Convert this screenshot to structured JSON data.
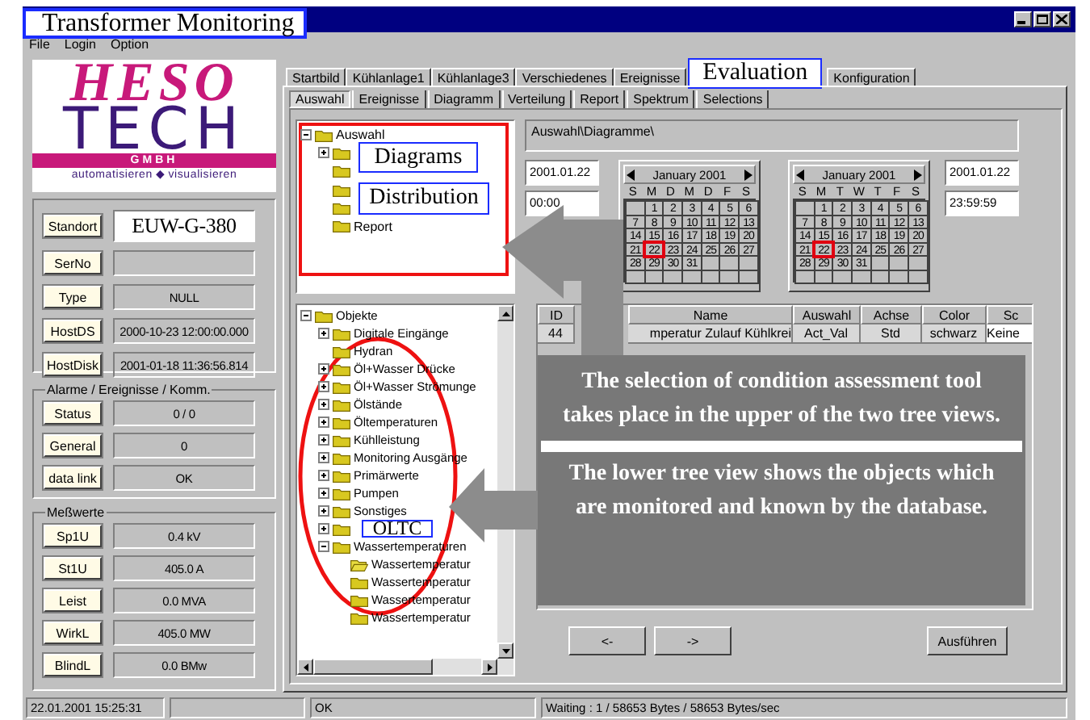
{
  "window": {
    "title_label": "Transformer Monitoring"
  },
  "menu": [
    "File",
    "Login",
    "Option"
  ],
  "logo": {
    "script": "HESO",
    "wordmark": "TECH",
    "legal_form": "GMBH",
    "slogan": "automatisieren ◆ visualisieren"
  },
  "info_fields": [
    {
      "label": "Standort",
      "value": "EUW-G-380",
      "kind": "highlight"
    },
    {
      "label": "SerNo",
      "kind": "plain"
    },
    {
      "label": "Type",
      "value": "NULL",
      "kind": "plain"
    },
    {
      "label": "HostDS",
      "value": "2000-10-23 12:00:00.000",
      "kind": "plain"
    },
    {
      "label": "HostDisk",
      "value": "2001-01-18 11:36:56.814",
      "kind": "plain"
    }
  ],
  "alarm_group": {
    "title": "Alarme / Ereignisse / Komm.",
    "fields": [
      {
        "label": "Status",
        "value": "0 / 0"
      },
      {
        "label": "General",
        "value": "0"
      },
      {
        "label": "data link",
        "value": "OK"
      }
    ]
  },
  "measurements": {
    "title": "Meßwerte",
    "fields": [
      {
        "label": "Sp1U",
        "value": "0.4 kV"
      },
      {
        "label": "St1U",
        "value": "405.0 A"
      },
      {
        "label": "Leist",
        "value": "0.0 MVA"
      },
      {
        "label": "WirkL",
        "value": "405.0 MW"
      },
      {
        "label": "BlindL",
        "value": "0.0 BMw"
      }
    ]
  },
  "main_tabs": [
    {
      "label": "Startbild",
      "selected": false
    },
    {
      "label": "Kühlanlage1",
      "selected": false
    },
    {
      "label": "Kühlanlage3",
      "selected": false
    },
    {
      "label": "Verschiedenes",
      "selected": false
    },
    {
      "label": "Ereignisse",
      "selected": false
    },
    {
      "label": "Konfiguration",
      "selected": false
    }
  ],
  "evaluation_label": "Evaluation",
  "sub_tabs": [
    {
      "label": "Auswahl",
      "selected": true
    },
    {
      "label": "Ereignisse",
      "selected": false
    },
    {
      "label": "Diagramm",
      "selected": false
    },
    {
      "label": "Verteilung",
      "selected": false
    },
    {
      "label": "Report",
      "selected": false
    },
    {
      "label": "Spektrum",
      "selected": false
    },
    {
      "label": "Selections",
      "selected": false
    }
  ],
  "upper_tree": [
    {
      "label": "Auswahl",
      "kind": "folder",
      "expanded": true,
      "children": [
        {
          "kind": "folder",
          "expanded": false
        },
        {
          "kind": "folder"
        },
        {
          "kind": "folder"
        },
        {
          "kind": "folder"
        },
        {
          "label": "Report",
          "kind": "folder"
        }
      ]
    }
  ],
  "upper_tree_labels": [
    "Diagrams",
    "Distribution"
  ],
  "path_field": "Auswahl\\Diagramme\\",
  "date_range": {
    "start_date": "2001.01.22",
    "start_time": "00:00",
    "end_date": "2001.01.22",
    "end_time": "23:59:59"
  },
  "calendars": [
    {
      "month": "January 2001",
      "weekdays": [
        "S",
        "M",
        "D",
        "M",
        "D",
        "F",
        "S"
      ],
      "weeks": [
        {
          "days": [
            {
              "day": "1",
              "selected": false
            },
            {
              "day": "2",
              "selected": false
            },
            {
              "day": "3",
              "selected": false
            },
            {
              "day": "4",
              "selected": false
            },
            {
              "day": "5",
              "selected": false
            },
            {
              "day": "6",
              "selected": false
            }
          ]
        },
        {
          "days": [
            {
              "day": "7",
              "selected": false
            },
            {
              "day": "8",
              "selected": false
            },
            {
              "day": "9",
              "selected": false
            },
            {
              "day": "10",
              "selected": false
            },
            {
              "day": "11",
              "selected": false
            },
            {
              "day": "12",
              "selected": false
            },
            {
              "day": "13",
              "selected": false
            }
          ]
        },
        {
          "days": [
            {
              "day": "14",
              "selected": false
            },
            {
              "day": "15",
              "selected": false
            },
            {
              "day": "16",
              "selected": false
            },
            {
              "day": "17",
              "selected": false
            },
            {
              "day": "18",
              "selected": false
            },
            {
              "day": "19",
              "selected": false
            },
            {
              "day": "20",
              "selected": false
            }
          ]
        },
        {
          "days": [
            {
              "day": "21",
              "selected": false
            },
            {
              "day": "22",
              "selected": true
            },
            {
              "day": "23",
              "selected": false
            },
            {
              "day": "24",
              "selected": false
            },
            {
              "day": "25",
              "selected": false
            },
            {
              "day": "26",
              "selected": false
            },
            {
              "day": "27",
              "selected": false
            }
          ]
        },
        {
          "days": [
            {
              "day": "28",
              "selected": false
            },
            {
              "day": "29",
              "selected": false
            },
            {
              "day": "30",
              "selected": false
            },
            {
              "day": "31",
              "selected": false
            }
          ]
        }
      ]
    },
    {
      "month": "January 2001",
      "weekdays": [
        "S",
        "M",
        "T",
        "W",
        "T",
        "F",
        "S"
      ],
      "weeks": [
        {
          "days": [
            {
              "day": "1",
              "selected": false
            },
            {
              "day": "2",
              "selected": false
            },
            {
              "day": "3",
              "selected": false
            },
            {
              "day": "4",
              "selected": false
            },
            {
              "day": "5",
              "selected": false
            },
            {
              "day": "6",
              "selected": false
            }
          ]
        },
        {
          "days": [
            {
              "day": "7",
              "selected": false
            },
            {
              "day": "8",
              "selected": false
            },
            {
              "day": "9",
              "selected": false
            },
            {
              "day": "10",
              "selected": false
            },
            {
              "day": "11",
              "selected": false
            },
            {
              "day": "12",
              "selected": false
            },
            {
              "day": "13",
              "selected": false
            }
          ]
        },
        {
          "days": [
            {
              "day": "14",
              "selected": false
            },
            {
              "day": "15",
              "selected": false
            },
            {
              "day": "16",
              "selected": false
            },
            {
              "day": "17",
              "selected": false
            },
            {
              "day": "18",
              "selected": false
            },
            {
              "day": "19",
              "selected": false
            },
            {
              "day": "20",
              "selected": false
            }
          ]
        },
        {
          "days": [
            {
              "day": "21",
              "selected": false
            },
            {
              "day": "22",
              "selected": true
            },
            {
              "day": "23",
              "selected": false
            },
            {
              "day": "24",
              "selected": false
            },
            {
              "day": "25",
              "selected": false
            },
            {
              "day": "26",
              "selected": false
            },
            {
              "day": "27",
              "selected": false
            }
          ]
        },
        {
          "days": [
            {
              "day": "28",
              "selected": false
            },
            {
              "day": "29",
              "selected": false
            },
            {
              "day": "30",
              "selected": false
            },
            {
              "day": "31",
              "selected": false
            }
          ]
        }
      ]
    }
  ],
  "lower_tree": [
    {
      "label": "Objekte",
      "kind": "folder",
      "expanded": true,
      "children": [
        {
          "label": "Digitale Eingänge",
          "kind": "folder",
          "expanded": false
        },
        {
          "label": "Hydran",
          "kind": "folder"
        },
        {
          "label": "Öl+Wasser Drücke",
          "kind": "folder",
          "expanded": false
        },
        {
          "label": "Öl+Wasser Strömunge",
          "kind": "folder",
          "expanded": false
        },
        {
          "label": "Ölstände",
          "kind": "folder",
          "expanded": false
        },
        {
          "label": "Öltemperaturen",
          "kind": "folder",
          "expanded": false
        },
        {
          "label": "Kühlleistung",
          "kind": "folder",
          "expanded": false
        },
        {
          "label": "Monitoring Ausgänge",
          "kind": "folder",
          "expanded": false
        },
        {
          "label": "Primärwerte",
          "kind": "folder",
          "expanded": false
        },
        {
          "label": "Pumpen",
          "kind": "folder",
          "expanded": false
        },
        {
          "label": "Sonstiges",
          "kind": "folder",
          "expanded": false
        },
        {
          "kind": "folder",
          "expanded": false
        },
        {
          "label": "Wassertemperaturen",
          "kind": "folder",
          "expanded": true,
          "children": [
            {
              "label": "Wassertemperatur",
              "kind": "open-folder"
            },
            {
              "label": "Wassertemperatur",
              "kind": "folder"
            },
            {
              "label": "Wassertemperatur",
              "kind": "folder"
            },
            {
              "label": "Wassertemperatur",
              "kind": "folder"
            }
          ]
        }
      ]
    }
  ],
  "oltc_label": "OLTC",
  "table": {
    "columns": [
      "ID",
      "Name",
      "Auswahl",
      "Achse",
      "Color",
      "Sc"
    ],
    "rows": [
      [
        "44",
        "mperatur Zulauf Kühlkrei",
        "Act_Val",
        "Std",
        "schwarz",
        "Keine"
      ]
    ]
  },
  "notes": [
    "The selection of condition assessment tool takes place in the upper of the two tree views.",
    "The lower tree view shows the objects which are monitored and known by the database."
  ],
  "buttons": [
    "<-",
    "->",
    "Ausführen"
  ],
  "status_bar": [
    "22.01.2001 15:25:31",
    "OK",
    "Waiting : 1 / 58653 Bytes / 58653 Bytes/sec"
  ]
}
